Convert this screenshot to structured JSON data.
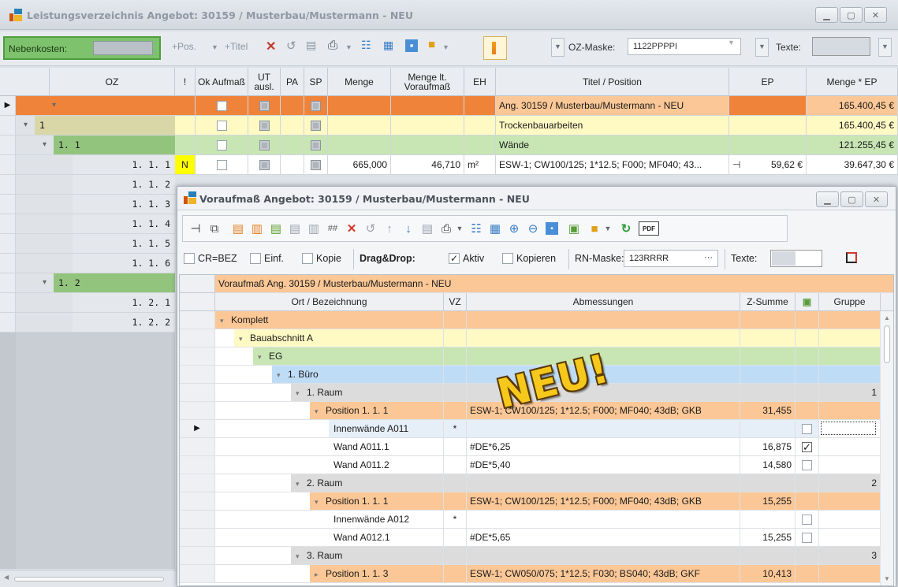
{
  "main_window": {
    "title": "Leistungsverzeichnis Angebot: 30159 / Musterbau/Mustermann - NEU",
    "toolbar": {
      "nebenkosten_label": "Nebenkosten:",
      "pos_label": "+Pos.",
      "titel_label": "+Titel",
      "oz_mask_label": "OZ-Maske:",
      "oz_mask_value": "1122PPPPI",
      "texte_label": "Texte:"
    },
    "columns": [
      "OZ",
      "!",
      "Ok Aufmaß",
      "UT ausl.",
      "PA",
      "SP",
      "Menge",
      "Menge lt. Voraufmaß",
      "EH",
      "Titel / Position",
      "EP",
      "Menge * EP"
    ],
    "rows": [
      {
        "oz": "",
        "flag": "",
        "menge": "",
        "menge_va": "",
        "eh": "",
        "titel": "Ang. 30159 / Musterbau/Mustermann - NEU",
        "ep": "",
        "total": "165.400,45 €"
      },
      {
        "oz": "1",
        "flag": "",
        "menge": "",
        "menge_va": "",
        "eh": "",
        "titel": "Trockenbauarbeiten",
        "ep": "",
        "total": "165.400,45 €"
      },
      {
        "oz": "1. 1",
        "flag": "",
        "menge": "",
        "menge_va": "",
        "eh": "",
        "titel": "Wände",
        "ep": "",
        "total": "121.255,45 €"
      },
      {
        "oz": "1. 1.  1",
        "flag": "N",
        "menge": "665,000",
        "menge_va": "46,710",
        "eh": "m²",
        "titel": "ESW-1; CW100/125; 1*12.5; F000; MF040; 43...",
        "ep": "59,62 €",
        "total": "39.647,30 €"
      },
      {
        "oz": "1. 1.  2"
      },
      {
        "oz": "1. 1.  3"
      },
      {
        "oz": "1. 1.  4"
      },
      {
        "oz": "1. 1.  5"
      },
      {
        "oz": "1. 1.  6"
      },
      {
        "oz": "1. 2"
      },
      {
        "oz": "1. 2.  1"
      },
      {
        "oz": "1. 2.  2"
      }
    ]
  },
  "voraufmass_window": {
    "title": "Voraufmaß Angebot: 30159 / Musterbau/Mustermann - NEU",
    "options": {
      "cr_bez": "CR=BEZ",
      "einf": "Einf.",
      "kopie": "Kopie",
      "dragdrop": "Drag&Drop:",
      "aktiv": "Aktiv",
      "kopieren": "Kopieren",
      "rn_mask_label": "RN-Maske:",
      "rn_mask_value": "123RRRR",
      "rn_more": "···",
      "texte_label": "Texte:"
    },
    "group_header": "Voraufmaß Ang. 30159 / Musterbau/Mustermann - NEU",
    "columns": {
      "ort": "Ort / Bezeichnung",
      "vz": "VZ",
      "abm": "Abmessungen",
      "zsum": "Z-Summe",
      "gruppe": "Gruppe"
    },
    "rows": [
      {
        "label": "Komplett"
      },
      {
        "label": "Bauabschnitt A"
      },
      {
        "label": "EG"
      },
      {
        "label": "1. Büro"
      },
      {
        "label": "1. Raum",
        "gruppe": "1"
      },
      {
        "label": "Position  1. 1.  1",
        "abm": "ESW-1; CW100/125; 1*12.5; F000; MF040; 43dB; GKB",
        "zsum": "31,455"
      },
      {
        "label": "Innenwände A011",
        "vz": "*"
      },
      {
        "label": "Wand A011.1",
        "abm": "#DE*6,25",
        "zsum": "16,875"
      },
      {
        "label": "Wand A011.2",
        "abm": "#DE*5,40",
        "zsum": "14,580"
      },
      {
        "label": "2. Raum",
        "gruppe": "2"
      },
      {
        "label": "Position  1. 1.  1",
        "abm": "ESW-1; CW100/125; 1*12.5; F000; MF040; 43dB; GKB",
        "zsum": "15,255"
      },
      {
        "label": "Innenwände A012",
        "vz": "*"
      },
      {
        "label": "Wand A012.1",
        "abm": "#DE*5,65",
        "zsum": "15,255"
      },
      {
        "label": "3. Raum",
        "gruppe": "3"
      },
      {
        "label": "Position  1. 1.  3",
        "abm": "ESW-1; CW050/075; 1*12.5; F030; BS040; 43dB; GKF",
        "zsum": "10,413"
      }
    ]
  },
  "badge": "NEU!",
  "colors": {
    "orange": "#fbc796",
    "yellow": "#fff9c4",
    "green": "#c8e6b4",
    "blue": "#bfdcf7",
    "gray": "#dcdcdc",
    "accent_orange": "#e87722"
  }
}
